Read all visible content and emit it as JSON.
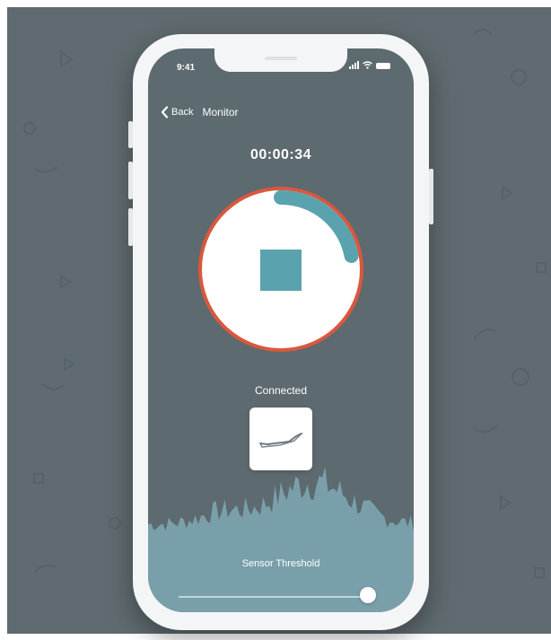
{
  "status_bar": {
    "time": "9:41"
  },
  "nav": {
    "back_label": "Back",
    "title": "Monitor"
  },
  "session": {
    "elapsed": "00:00:34",
    "progress_fraction": 0.22,
    "connection_status": "Connected"
  },
  "sensor": {
    "icon": "foot-sensor-icon"
  },
  "threshold": {
    "label": "Sensor Threshold",
    "value_fraction": 0.97
  },
  "colors": {
    "background": "#5f6b70",
    "screen": "#5d6a6f",
    "ring": "#d9583e",
    "accent": "#5aa3ae",
    "wave": "#7aa3ad"
  },
  "icons": [
    "back-chevron-icon",
    "signal-icon",
    "wifi-icon",
    "battery-icon",
    "stop-icon",
    "foot-sensor-icon"
  ]
}
